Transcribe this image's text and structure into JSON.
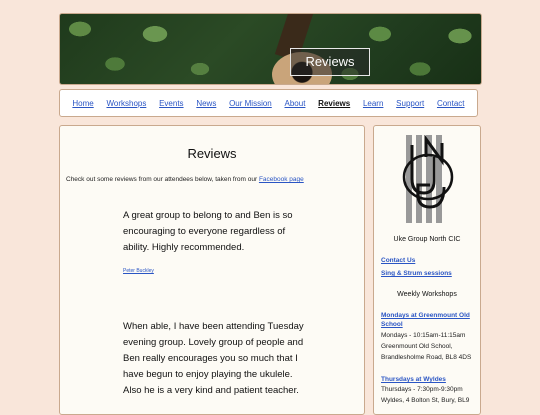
{
  "banner": {
    "title": "Reviews"
  },
  "nav": {
    "items": [
      {
        "label": "Home"
      },
      {
        "label": "Workshops"
      },
      {
        "label": "Events"
      },
      {
        "label": "News"
      },
      {
        "label": "Our Mission"
      },
      {
        "label": "About"
      },
      {
        "label": "Reviews",
        "active": true
      },
      {
        "label": "Learn"
      },
      {
        "label": "Support"
      },
      {
        "label": "Contact"
      }
    ]
  },
  "main": {
    "heading": "Reviews",
    "intro_text": "Check out some reviews from our attendees below, taken from our ",
    "intro_link": "Facebook page",
    "reviews": [
      {
        "text": "A great group to belong to and Ben is so encouraging to everyone regardless of ability. Highly recommended.",
        "author": "Peter Buckley"
      },
      {
        "text": "When able, I have been attending Tuesday evening group. Lovely group of people and Ben really encourages you so much that I have begun to enjoy playing the ukulele. Also he is a very kind and patient teacher."
      }
    ]
  },
  "sidebar": {
    "org_name": "Uke Group North CIC",
    "contact_link": "Contact Us",
    "sing_link": "Sing & Strum sessions",
    "weekly_heading": "Weekly Workshops",
    "schedule": [
      {
        "title": "Mondays at Greenmount Old School",
        "details": "Mondays - 10:15am-11:15am Greenmount Old School, Brandlesholme Road, BL8 4DS"
      },
      {
        "title": "Thursdays at Wyldes",
        "details": "Thursdays - 7:30pm-9:30pm Wyldes, 4 Bolton St, Bury, BL9"
      }
    ]
  },
  "colors": {
    "link": "#2a55c4",
    "page_bg": "#f9e6da",
    "panel_bg": "#fdfbf5",
    "border": "#c9a98e"
  }
}
